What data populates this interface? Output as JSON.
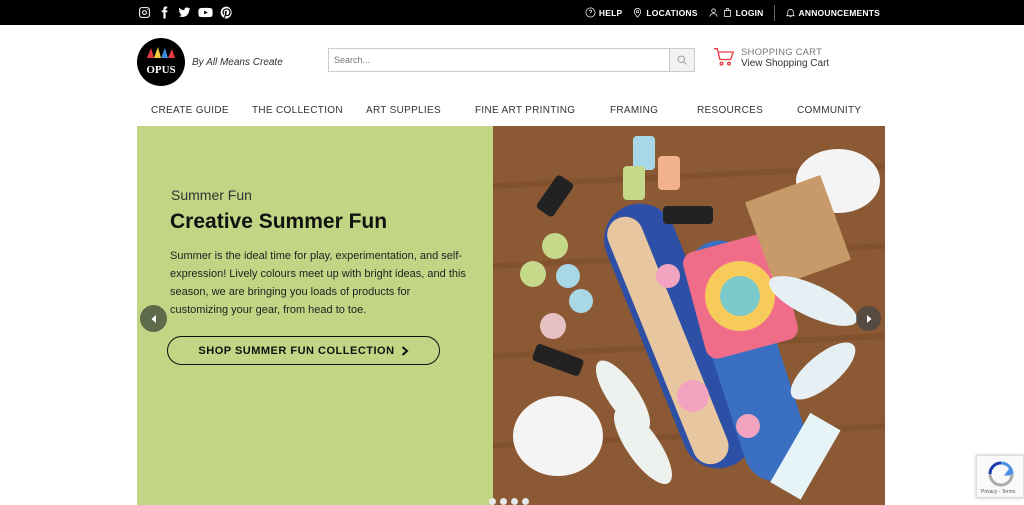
{
  "topbar": {
    "social_icons": [
      "instagram-icon",
      "facebook-icon",
      "twitter-icon",
      "youtube-icon",
      "pinterest-icon"
    ],
    "links": [
      {
        "label": "HELP",
        "icon": "help-icon"
      },
      {
        "label": "LOCATIONS",
        "icon": "location-pin-icon"
      },
      {
        "label": "LOGIN",
        "icon": "user-icon"
      },
      {
        "label": "ANNOUNCEMENTS",
        "icon": "bell-icon"
      }
    ]
  },
  "header": {
    "logo_text": "OPUS",
    "tagline": "By All Means Create",
    "search": {
      "placeholder": "Search..."
    },
    "cart": {
      "title": "SHOPPING CART",
      "link": "View Shopping Cart"
    }
  },
  "nav": {
    "items": [
      "CREATE GUIDE",
      "THE COLLECTION",
      "ART SUPPLIES",
      "FINE ART PRINTING",
      "FRAMING",
      "RESOURCES",
      "COMMUNITY"
    ]
  },
  "hero": {
    "eyebrow": "Summer Fun",
    "headline": "Creative Summer Fun",
    "body": "Summer is the ideal time for play, experimentation, and self-expression! Lively colours meet up with bright ideas, and this season, we are bringing you loads of products for customizing your gear, from head to toe.",
    "cta_label": "SHOP SUMMER FUN COLLECTION",
    "slide_count": 4,
    "active_slide": 1
  },
  "colors": {
    "hero_green": "#c2d584",
    "cart_red": "#e63946",
    "topbar": "#000000"
  }
}
